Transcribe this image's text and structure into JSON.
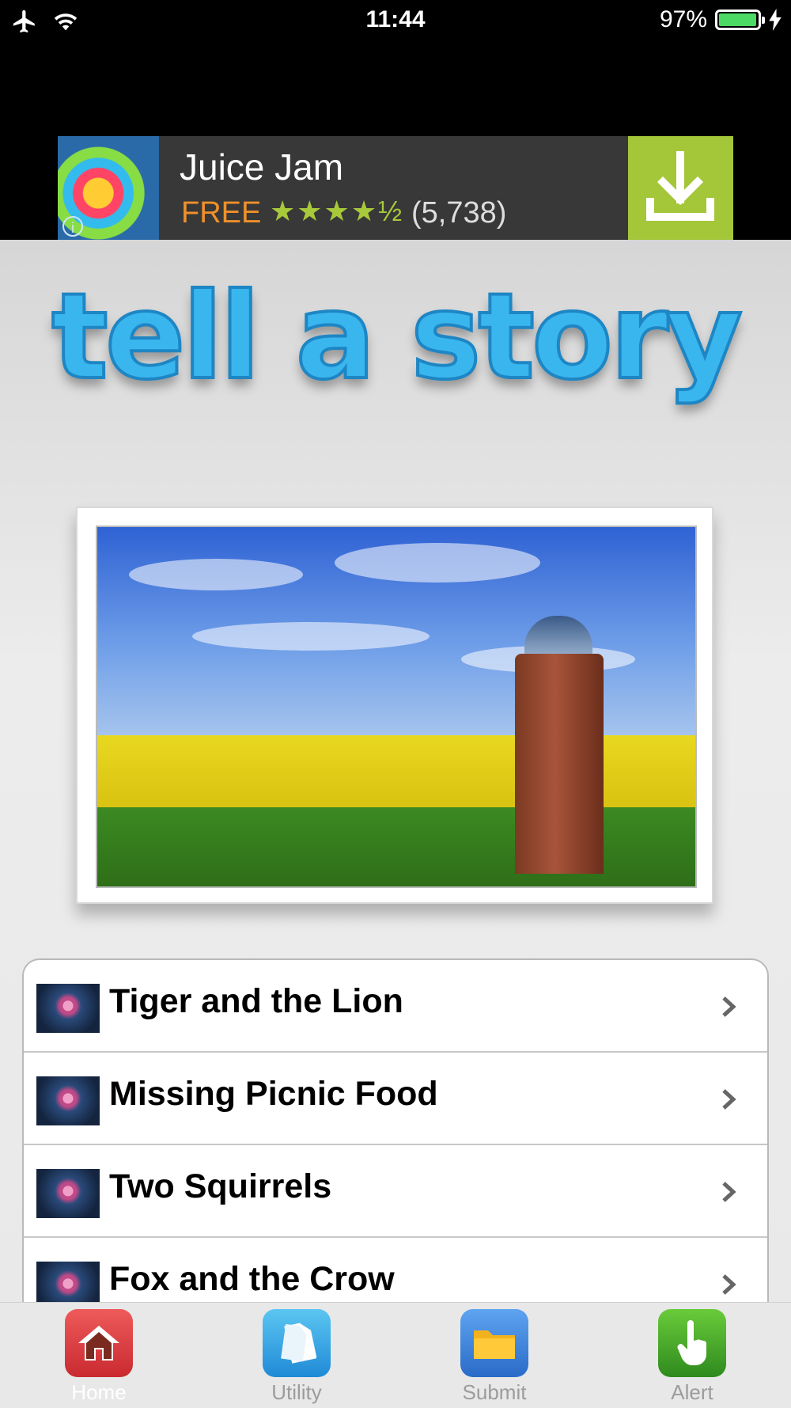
{
  "status": {
    "time": "11:44",
    "battery": "97%",
    "battery_level": 0.97
  },
  "ad": {
    "title": "Juice Jam",
    "price": "FREE",
    "rating": "★★★★½",
    "reviews": "(5,738)"
  },
  "app": {
    "title": "tell a story"
  },
  "stories": [
    {
      "label": "Tiger and the Lion"
    },
    {
      "label": "Missing Picnic Food"
    },
    {
      "label": "Two Squirrels"
    },
    {
      "label": "Fox and the Crow"
    }
  ],
  "tabs": [
    {
      "label": "Home",
      "icon": "home-icon",
      "color": "#d9323a",
      "active": true
    },
    {
      "label": "Utility",
      "icon": "document-icon",
      "color": "#2a9ae0",
      "active": false
    },
    {
      "label": "Submit",
      "icon": "folder-icon",
      "color": "#3a7fd8",
      "active": false
    },
    {
      "label": "Alert",
      "icon": "hand-pointer-icon",
      "color": "#3fa32a",
      "active": false
    }
  ],
  "colors": {
    "accent_blue": "#3ab6ee",
    "ad_button": "#a4c639",
    "ad_price": "#f0902a"
  }
}
